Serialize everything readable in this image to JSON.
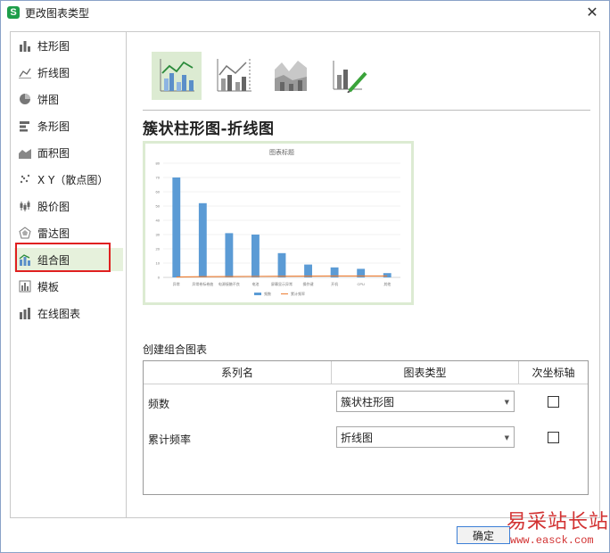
{
  "window": {
    "title": "更改图表类型",
    "app_icon_letter": "S"
  },
  "sidebar": {
    "items": [
      {
        "label": "柱形图",
        "icon": "bar-chart-icon"
      },
      {
        "label": "折线图",
        "icon": "line-chart-icon"
      },
      {
        "label": "饼图",
        "icon": "pie-chart-icon"
      },
      {
        "label": "条形图",
        "icon": "horizontal-bar-icon"
      },
      {
        "label": "面积图",
        "icon": "area-chart-icon"
      },
      {
        "label": "X Y（散点图）",
        "icon": "scatter-chart-icon"
      },
      {
        "label": "股价图",
        "icon": "stock-chart-icon"
      },
      {
        "label": "雷达图",
        "icon": "radar-chart-icon"
      },
      {
        "label": "组合图",
        "icon": "combo-chart-icon"
      },
      {
        "label": "模板",
        "icon": "template-icon"
      },
      {
        "label": "在线图表",
        "icon": "online-chart-icon"
      }
    ],
    "selected": "组合图"
  },
  "subtypes": {
    "items": [
      "clustered-column-line-icon",
      "clustered-column-line-secondary-icon",
      "stacked-area-column-icon",
      "custom-combo-icon"
    ],
    "selected_index": 0,
    "heading": "簇状柱形图-折线图"
  },
  "chart_data": {
    "type": "bar",
    "title": "图表标题",
    "categories": [
      "异常",
      "异常卷标卷曲",
      "电源接触不良",
      "电池",
      "屏幕显示异常",
      "操作键",
      "开机",
      "CPU",
      "其他"
    ],
    "series": [
      {
        "name": "频数",
        "values": [
          70,
          52,
          31,
          30,
          17,
          9,
          7,
          6,
          3
        ],
        "kind": "bar",
        "color": "#5b9bd5"
      },
      {
        "name": "累计频率",
        "values": [
          0.3,
          0.5,
          0.6,
          0.7,
          0.8,
          0.9,
          0.95,
          0.98,
          1.0
        ],
        "kind": "line",
        "color": "#ed7d31"
      }
    ],
    "yticks": [
      "0",
      "10",
      "20",
      "30",
      "40",
      "50",
      "60",
      "70",
      "80"
    ],
    "ylim": [
      0,
      80
    ],
    "grid": true,
    "legend": "bottom"
  },
  "combo": {
    "section_label": "创建组合图表",
    "headers": {
      "series": "系列名",
      "type": "图表类型",
      "axis": "次坐标轴"
    },
    "rows": [
      {
        "series": "频数",
        "type": "簇状柱形图",
        "secondary": false
      },
      {
        "series": "累计频率",
        "type": "折线图",
        "secondary": false
      }
    ]
  },
  "buttons": {
    "ok": "确定"
  },
  "watermark": {
    "title": "易采站长站",
    "url": "www.easck.com"
  },
  "colors": {
    "accent": "#1e9e4a",
    "selected_bg": "#dcebd2",
    "highlight_box": "#e02020",
    "bar": "#5b9bd5",
    "line": "#ed7d31"
  }
}
